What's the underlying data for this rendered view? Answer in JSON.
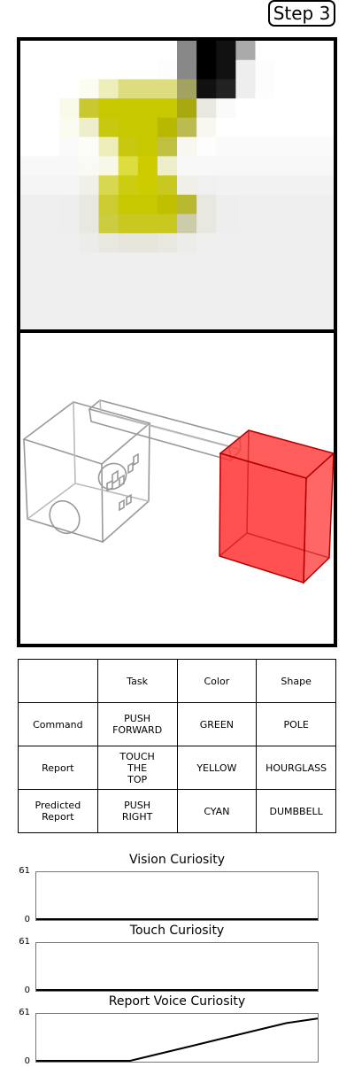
{
  "step_label": "Step 3",
  "pixel_view": {
    "rows": [
      [
        "fff",
        "fff",
        "fff",
        "fff",
        "fff",
        "fff",
        "fff",
        "fff",
        "888",
        "000",
        "111",
        "aaa",
        "fff",
        "fff",
        "fff",
        "fff"
      ],
      [
        "fff",
        "fff",
        "fff",
        "fff",
        "fff",
        "fff",
        "fff",
        "fdfdfd",
        "888",
        "000",
        "111",
        "eee",
        "fdfdfd",
        "fff",
        "fff",
        "fff"
      ],
      [
        "fff",
        "fff",
        "fff",
        "fcfcf2",
        "eeeebb",
        "dddd80",
        "dddd80",
        "dddd80",
        "a3a360",
        "111",
        "222",
        "eee",
        "fdfdfd",
        "fff",
        "fff",
        "fff"
      ],
      [
        "fff",
        "fff",
        "fafae8",
        "c8c830",
        "c8c800",
        "c8c800",
        "c8c800",
        "c8c800",
        "a8a810",
        "e8e8e0",
        "fafafa",
        "fff",
        "fff",
        "fff",
        "fff",
        "fff"
      ],
      [
        "fff",
        "fff",
        "fbfbf0",
        "eeeecc",
        "c8c810",
        "c8c800",
        "c8c800",
        "b8b800",
        "bbbb50",
        "f8f8f0",
        "fff",
        "fff",
        "fff",
        "fff",
        "fff",
        "fff"
      ],
      [
        "fff",
        "fff",
        "fafafa",
        "fdfdf8",
        "eeeebb",
        "c8c810",
        "c8c800",
        "c0c040",
        "f8f8f0",
        "fdfdfd",
        "fafafa",
        "fafafa",
        "fafafa",
        "fafafa",
        "fafafa",
        "fafafa"
      ],
      [
        "f8f8f8",
        "f8f8f8",
        "f8f8f8",
        "fafaf5",
        "f8f8e8",
        "dddd40",
        "cccc00",
        "eeeecc",
        "f8f8f8",
        "f8f8f8",
        "f8f8f8",
        "f8f8f8",
        "f8f8f8",
        "f8f8f8",
        "f8f8f8",
        "f8f8f8"
      ],
      [
        "f5f5f5",
        "f5f5f5",
        "f5f5f5",
        "f0f0e8",
        "d8d850",
        "cccc10",
        "cccc00",
        "c8c820",
        "f0f0e8",
        "f0f0f0",
        "f2f2f2",
        "f2f2f2",
        "f2f2f2",
        "f2f2f2",
        "f2f2f2",
        "f2f2f2"
      ],
      [
        "efefef",
        "efefef",
        "eeeeee",
        "e8e8e0",
        "cccc30",
        "c8c800",
        "c8c800",
        "c0c000",
        "b8b830",
        "e8e8e0",
        "eeeeee",
        "efefef",
        "efefef",
        "efefef",
        "efefef",
        "efefef"
      ],
      [
        "efefef",
        "efefef",
        "eeeeee",
        "e8e8e0",
        "cccc40",
        "c8c820",
        "c8c820",
        "c8c820",
        "ccccaa",
        "e8e8e0",
        "eeeeee",
        "efefef",
        "efefef",
        "efefef",
        "efefef",
        "efefef"
      ],
      [
        "efefef",
        "efefef",
        "efefef",
        "ececea",
        "e8e8e0",
        "e6e6dd",
        "e6e6dd",
        "e8e8e0",
        "ececea",
        "efefef",
        "efefef",
        "efefef",
        "efefef",
        "efefef",
        "efefef",
        "efefef"
      ],
      [
        "efefef",
        "efefef",
        "efefef",
        "efefef",
        "efefef",
        "efefef",
        "efefef",
        "efefef",
        "efefef",
        "efefef",
        "efefef",
        "efefef",
        "efefef",
        "efefef",
        "efefef",
        "efefef"
      ],
      [
        "efefef",
        "efefef",
        "efefef",
        "efefef",
        "efefef",
        "efefef",
        "efefef",
        "efefef",
        "efefef",
        "efefef",
        "efefef",
        "efefef",
        "efefef",
        "efefef",
        "efefef",
        "efefef"
      ],
      [
        "efefef",
        "efefef",
        "efefef",
        "efefef",
        "efefef",
        "efefef",
        "efefef",
        "efefef",
        "efefef",
        "efefef",
        "efefef",
        "efefef",
        "efefef",
        "efefef",
        "efefef",
        "efefef"
      ],
      [
        "efefef",
        "efefef",
        "efefef",
        "efefef",
        "efefef",
        "efefef",
        "efefef",
        "efefef",
        "efefef",
        "efefef",
        "efefef",
        "efefef",
        "efefef",
        "efefef",
        "efefef",
        "efefef"
      ]
    ]
  },
  "table": {
    "header": [
      "",
      "Task",
      "Color",
      "Shape"
    ],
    "rows": [
      [
        "Command",
        "PUSH\nFORWARD",
        "GREEN",
        "POLE"
      ],
      [
        "Report",
        "TOUCH\nTHE\nTOP",
        "YELLOW",
        "HOURGLASS"
      ],
      [
        "Predicted\nReport",
        "PUSH\nRIGHT",
        "CYAN",
        "DUMBBELL"
      ]
    ]
  },
  "graphs": [
    {
      "title": "Vision Curiosity",
      "ymax_label": "61",
      "ymin_label": "0",
      "ylim": [
        0,
        61
      ],
      "values": [
        0,
        0,
        0,
        0,
        0,
        0,
        0,
        0,
        0,
        0
      ]
    },
    {
      "title": "Touch Curiosity",
      "ymax_label": "61",
      "ymin_label": "0",
      "ylim": [
        0,
        61
      ],
      "values": [
        0,
        0,
        0,
        0,
        0,
        0,
        0,
        0,
        0,
        0
      ]
    },
    {
      "title": "Report Voice Curiosity",
      "ymax_label": "61",
      "ymin_label": "0",
      "ylim": [
        0,
        61
      ],
      "values": [
        0,
        0,
        0,
        0,
        10,
        20,
        30,
        40,
        50,
        56
      ]
    }
  ],
  "colors": {
    "red_box": "#ff3333",
    "graph_line": "#000000"
  }
}
